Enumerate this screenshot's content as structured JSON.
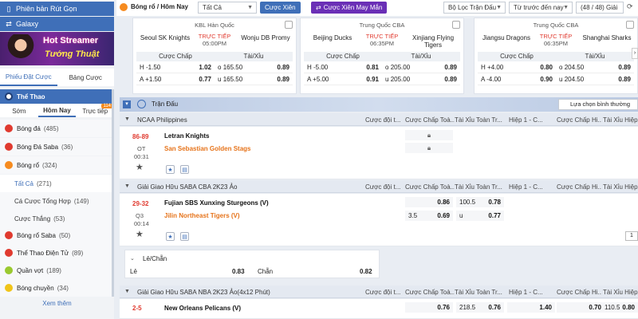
{
  "sidebar": {
    "top_buttons": [
      {
        "label": "Phiên bản Rút Gọn",
        "icon": "mobile-icon"
      },
      {
        "label": "Galaxy",
        "icon": "refresh-icon"
      }
    ],
    "promo": {
      "line1": "Hot Streamer",
      "line2": "Tướng Thuật"
    },
    "tabs": [
      "Phiếu Đặt Cược",
      "Bảng Cược"
    ],
    "sport_header": "Thể Thao",
    "time_tabs": [
      {
        "label": "Sớm"
      },
      {
        "label": "Hôm Nay"
      },
      {
        "label": "Trực tiếp",
        "badge": "114"
      }
    ],
    "items": [
      {
        "label": "Bóng đá",
        "count": "(485)",
        "color": "#e03a2f"
      },
      {
        "label": "Bóng Đá Saba",
        "count": "(36)",
        "color": "#e03a2f"
      },
      {
        "label": "Bóng rổ",
        "count": "(324)",
        "color": "#f68b1f"
      },
      {
        "label": "Tất Cả",
        "count": "(271)",
        "sub": "active"
      },
      {
        "label": "Cá Cược Tổng Hợp",
        "count": "(149)",
        "sub": "plain"
      },
      {
        "label": "Cược Thắng",
        "count": "(53)",
        "sub": "plain"
      },
      {
        "label": "Bóng rổ Saba",
        "count": "(50)",
        "color": "#e03a2f"
      },
      {
        "label": "Thể Thao Điện Tử",
        "count": "(89)",
        "color": "#e03a2f"
      },
      {
        "label": "Quần vợt",
        "count": "(189)",
        "color": "#9ac92f"
      },
      {
        "label": "Bóng chuyền",
        "count": "(34)",
        "color": "#f0c419"
      }
    ],
    "more": "Xem thêm"
  },
  "topbar": {
    "breadcrumb": "Bóng rổ / Hôm Nay",
    "select_all": "Tất Cả",
    "btn_cuoc_xien": "Cược Xiên",
    "btn_xien_may_man": "Cược Xiên May Mắn",
    "filter": "Bộ Lọc Trận Đấu",
    "time_filter": "Từ trước đến nay",
    "leagues": "(48 / 48) Giải"
  },
  "cards": [
    {
      "league": "KBL Hàn Quốc",
      "home": "Seoul SK Knights",
      "away": "Wonju DB Promy",
      "status": "TRỰC TIẾP",
      "time": "05:00PM",
      "h_line": "-1.50",
      "h_odd": "1.02",
      "o_line": "165.50",
      "o_odd": "0.89",
      "a_line": "+1.50",
      "a_odd": "0.77",
      "u_line": "165.50",
      "u_odd": "0.89"
    },
    {
      "league": "Trung Quốc CBA",
      "home": "Beijing Ducks",
      "away": "Xinjiang Flying Tigers",
      "status": "TRỰC TIẾP",
      "time": "06:35PM",
      "h_line": "-5.00",
      "h_odd": "0.81",
      "o_line": "205.00",
      "o_odd": "0.89",
      "a_line": "+5.00",
      "a_odd": "0.91",
      "u_line": "205.00",
      "u_odd": "0.89"
    },
    {
      "league": "Trung Quốc CBA",
      "home": "Jiangsu Dragons",
      "away": "Shanghai Sharks",
      "status": "TRỰC TIẾP",
      "time": "06:35PM",
      "h_line": "+4.00",
      "h_odd": "0.80",
      "o_line": "204.50",
      "o_odd": "0.89",
      "a_line": "-4.00",
      "a_odd": "0.90",
      "u_line": "204.50",
      "u_odd": "0.89"
    }
  ],
  "card_labels": {
    "handicap": "Cược Chấp",
    "ou": "Tài/Xỉu",
    "h": "H",
    "a": "A",
    "o": "o",
    "u": "u"
  },
  "main": {
    "section_title": "Trận Đấu",
    "sort_label": "Lựa chọn bình thường",
    "columns": [
      "Cược đội t...",
      "Cược Chấp Toà...",
      "Tài Xỉu Toàn Tr...",
      "Hiệp 1 - C...",
      "Cược Chấp Hi...",
      "Tài Xỉu Hiệp"
    ],
    "leagues": [
      {
        "name": "NCAA Philippines",
        "score": "86-89",
        "period": "OT",
        "clock": "00:31",
        "home": "Letran Knights",
        "away": "San Sebastian Golden Stags"
      },
      {
        "name": "Giải Giao Hữu SABA CBA 2K23 Ảo",
        "score": "29-32",
        "period": "Q3",
        "clock": "00:14",
        "home": "Fujian SBS Xunxing Sturgeons (V)",
        "away": "Jilin Northeast Tigers (V)",
        "r1_hdp": "0.86",
        "r1_ou_line": "100.5",
        "r1_ou": "0.78",
        "r2_hdp_line": "3.5",
        "r2_hdp": "0.69",
        "r2_ou_u": "u",
        "r2_ou": "0.77",
        "pager": "1"
      },
      {
        "name": "Giải Giao Hữu SABA NBA 2K23 Ảo(4x12 Phút)",
        "score": "2-5",
        "home": "New Orleans Pelicans (V)",
        "r1_hdp": "0.76",
        "r1_ou_line": "218.5",
        "r1_ou": "0.76",
        "h1_1x2": "1.40",
        "h1_hdp": "0.70",
        "h1_ou_line": "110.5",
        "h1_ou": "0.80"
      }
    ],
    "le_chan": {
      "title": "Lẻ/Chẵn",
      "le": "Lẻ",
      "le_odd": "0.83",
      "chan": "Chẵn",
      "chan_odd": "0.82"
    }
  }
}
